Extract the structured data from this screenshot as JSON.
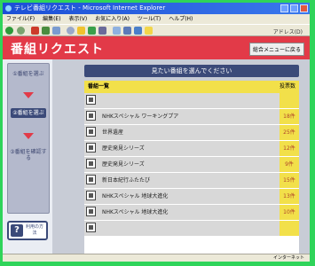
{
  "window": {
    "title": "テレビ番組リクエスト - Microsoft Internet Explorer"
  },
  "menubar": [
    "ファイル(F)",
    "編集(E)",
    "表示(V)",
    "お気に入り(A)",
    "ツール(T)",
    "ヘルプ(H)"
  ],
  "toolbar": {
    "address_fragment": "アドレス(D)"
  },
  "banner": {
    "title": "番組リクエスト",
    "menu_button": "総合メニューに戻る"
  },
  "steps": [
    {
      "label": "①番組を選ぶ",
      "active": false
    },
    {
      "label": "②番組を選ぶ",
      "active": true
    },
    {
      "label": "③番組を確認する",
      "active": false
    }
  ],
  "help": {
    "label": "利用の方法"
  },
  "prompt": "見たい番組を選んでください",
  "list": {
    "header_left": "番組一覧",
    "header_right": "投票数",
    "rows": [
      {
        "title": "",
        "count": ""
      },
      {
        "title": "NHKスペシャル ワーキングプア",
        "count": "18件"
      },
      {
        "title": "世界遺産",
        "count": "25件"
      },
      {
        "title": "歴史発見シリーズ",
        "count": "12件"
      },
      {
        "title": "歴史発見シリーズ",
        "count": "9件"
      },
      {
        "title": "新日本紀行ふたたび",
        "count": "15件"
      },
      {
        "title": "NHKスペシャル 地球大進化",
        "count": "13件"
      },
      {
        "title": "NHKスペシャル 地球大進化",
        "count": "10件"
      },
      {
        "title": "",
        "count": ""
      }
    ]
  },
  "status": {
    "zone": "インターネット"
  }
}
